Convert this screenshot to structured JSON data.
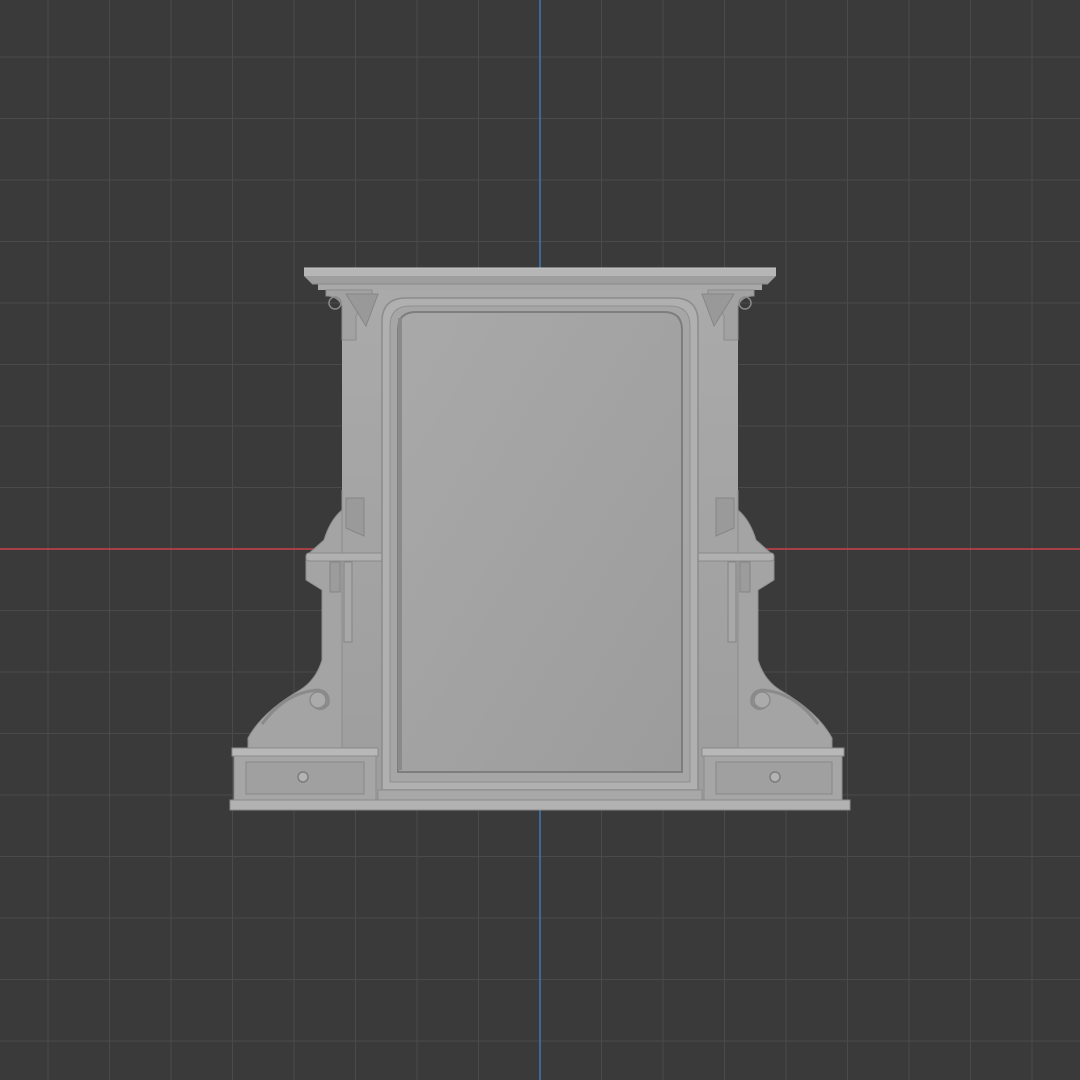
{
  "viewport": {
    "background": "#3a3a3a",
    "grid_minor_color": "#4a4a4a",
    "x_axis_color": "#c8424a",
    "y_axis_color": "#3d78b8"
  },
  "model": {
    "subject": "victorian-vanity-mirror-frame",
    "base_color": "#a3a3a3",
    "shadow_color": "#7a7a7a",
    "highlight_color": "#c0c0c0",
    "mirror_color": "#a0a0a0"
  }
}
